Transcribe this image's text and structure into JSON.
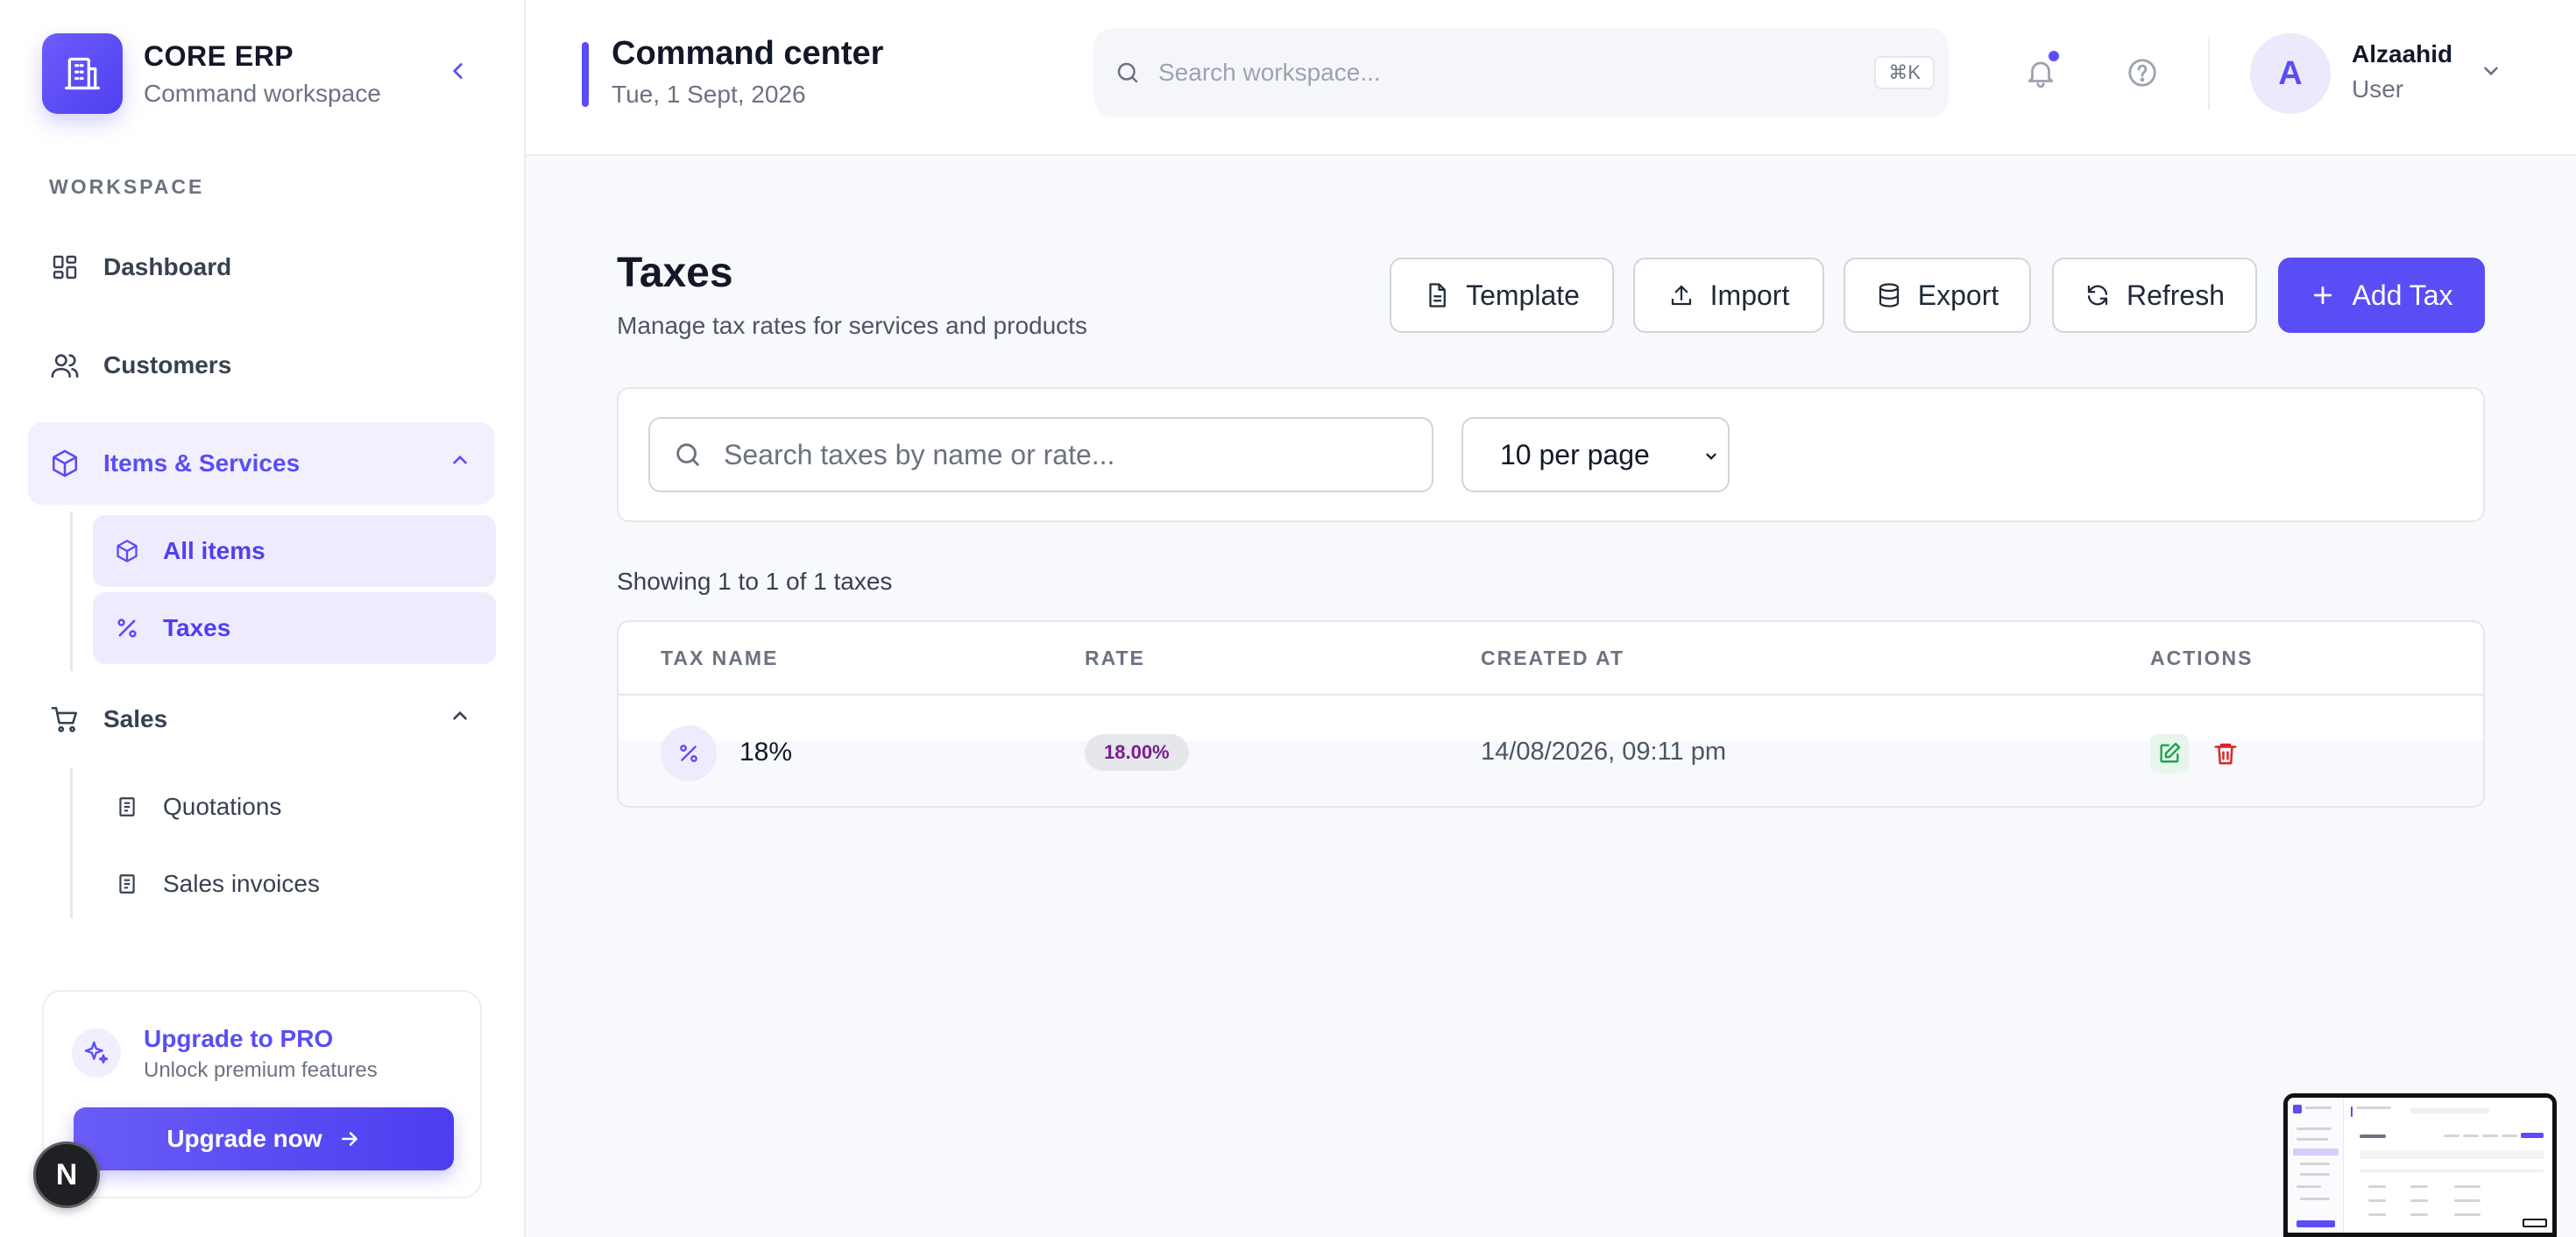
{
  "brand": {
    "title": "CORE ERP",
    "subtitle": "Command workspace"
  },
  "sidebar": {
    "section_label": "WORKSPACE",
    "items": [
      {
        "label": "Dashboard",
        "icon": "grid-icon"
      },
      {
        "label": "Customers",
        "icon": "users-icon"
      },
      {
        "label": "Items & Services",
        "icon": "box-icon",
        "expanded": true
      },
      {
        "label": "Sales",
        "icon": "cart-icon",
        "expanded": true
      }
    ],
    "items_sub": [
      {
        "label": "All items",
        "icon": "box-icon"
      },
      {
        "label": "Taxes",
        "icon": "percent-icon",
        "selected": true
      }
    ],
    "sales_sub": [
      {
        "label": "Quotations",
        "icon": "document-icon"
      },
      {
        "label": "Sales invoices",
        "icon": "document-icon"
      }
    ]
  },
  "upgrade": {
    "title": "Upgrade to PRO",
    "subtitle": "Unlock premium features",
    "button": "Upgrade now"
  },
  "dev_badge": "N",
  "header": {
    "title": "Command center",
    "date": "Tue, 1 Sept, 2026",
    "search_placeholder": "Search workspace...",
    "shortcut": "⌘K",
    "user": {
      "initial": "A",
      "name": "Alzaahid",
      "role": "User"
    }
  },
  "page": {
    "title": "Taxes",
    "subtitle": "Manage tax rates for services and products",
    "actions": {
      "template": "Template",
      "import": "Import",
      "export": "Export",
      "refresh": "Refresh",
      "add": "Add Tax"
    }
  },
  "filters": {
    "search_placeholder": "Search taxes by name or rate...",
    "per_page": "10 per page"
  },
  "results": {
    "showing": "Showing 1 to 1 of 1 taxes"
  },
  "table": {
    "columns": [
      "TAX NAME",
      "RATE",
      "CREATED AT",
      "ACTIONS"
    ],
    "rows": [
      {
        "name": "18%",
        "rate": "18.00%",
        "created_at": "14/08/2026, 09:11 pm"
      }
    ]
  },
  "colors": {
    "accent": "#5b4df5",
    "edit": "#16a34a",
    "delete": "#dc2626"
  }
}
